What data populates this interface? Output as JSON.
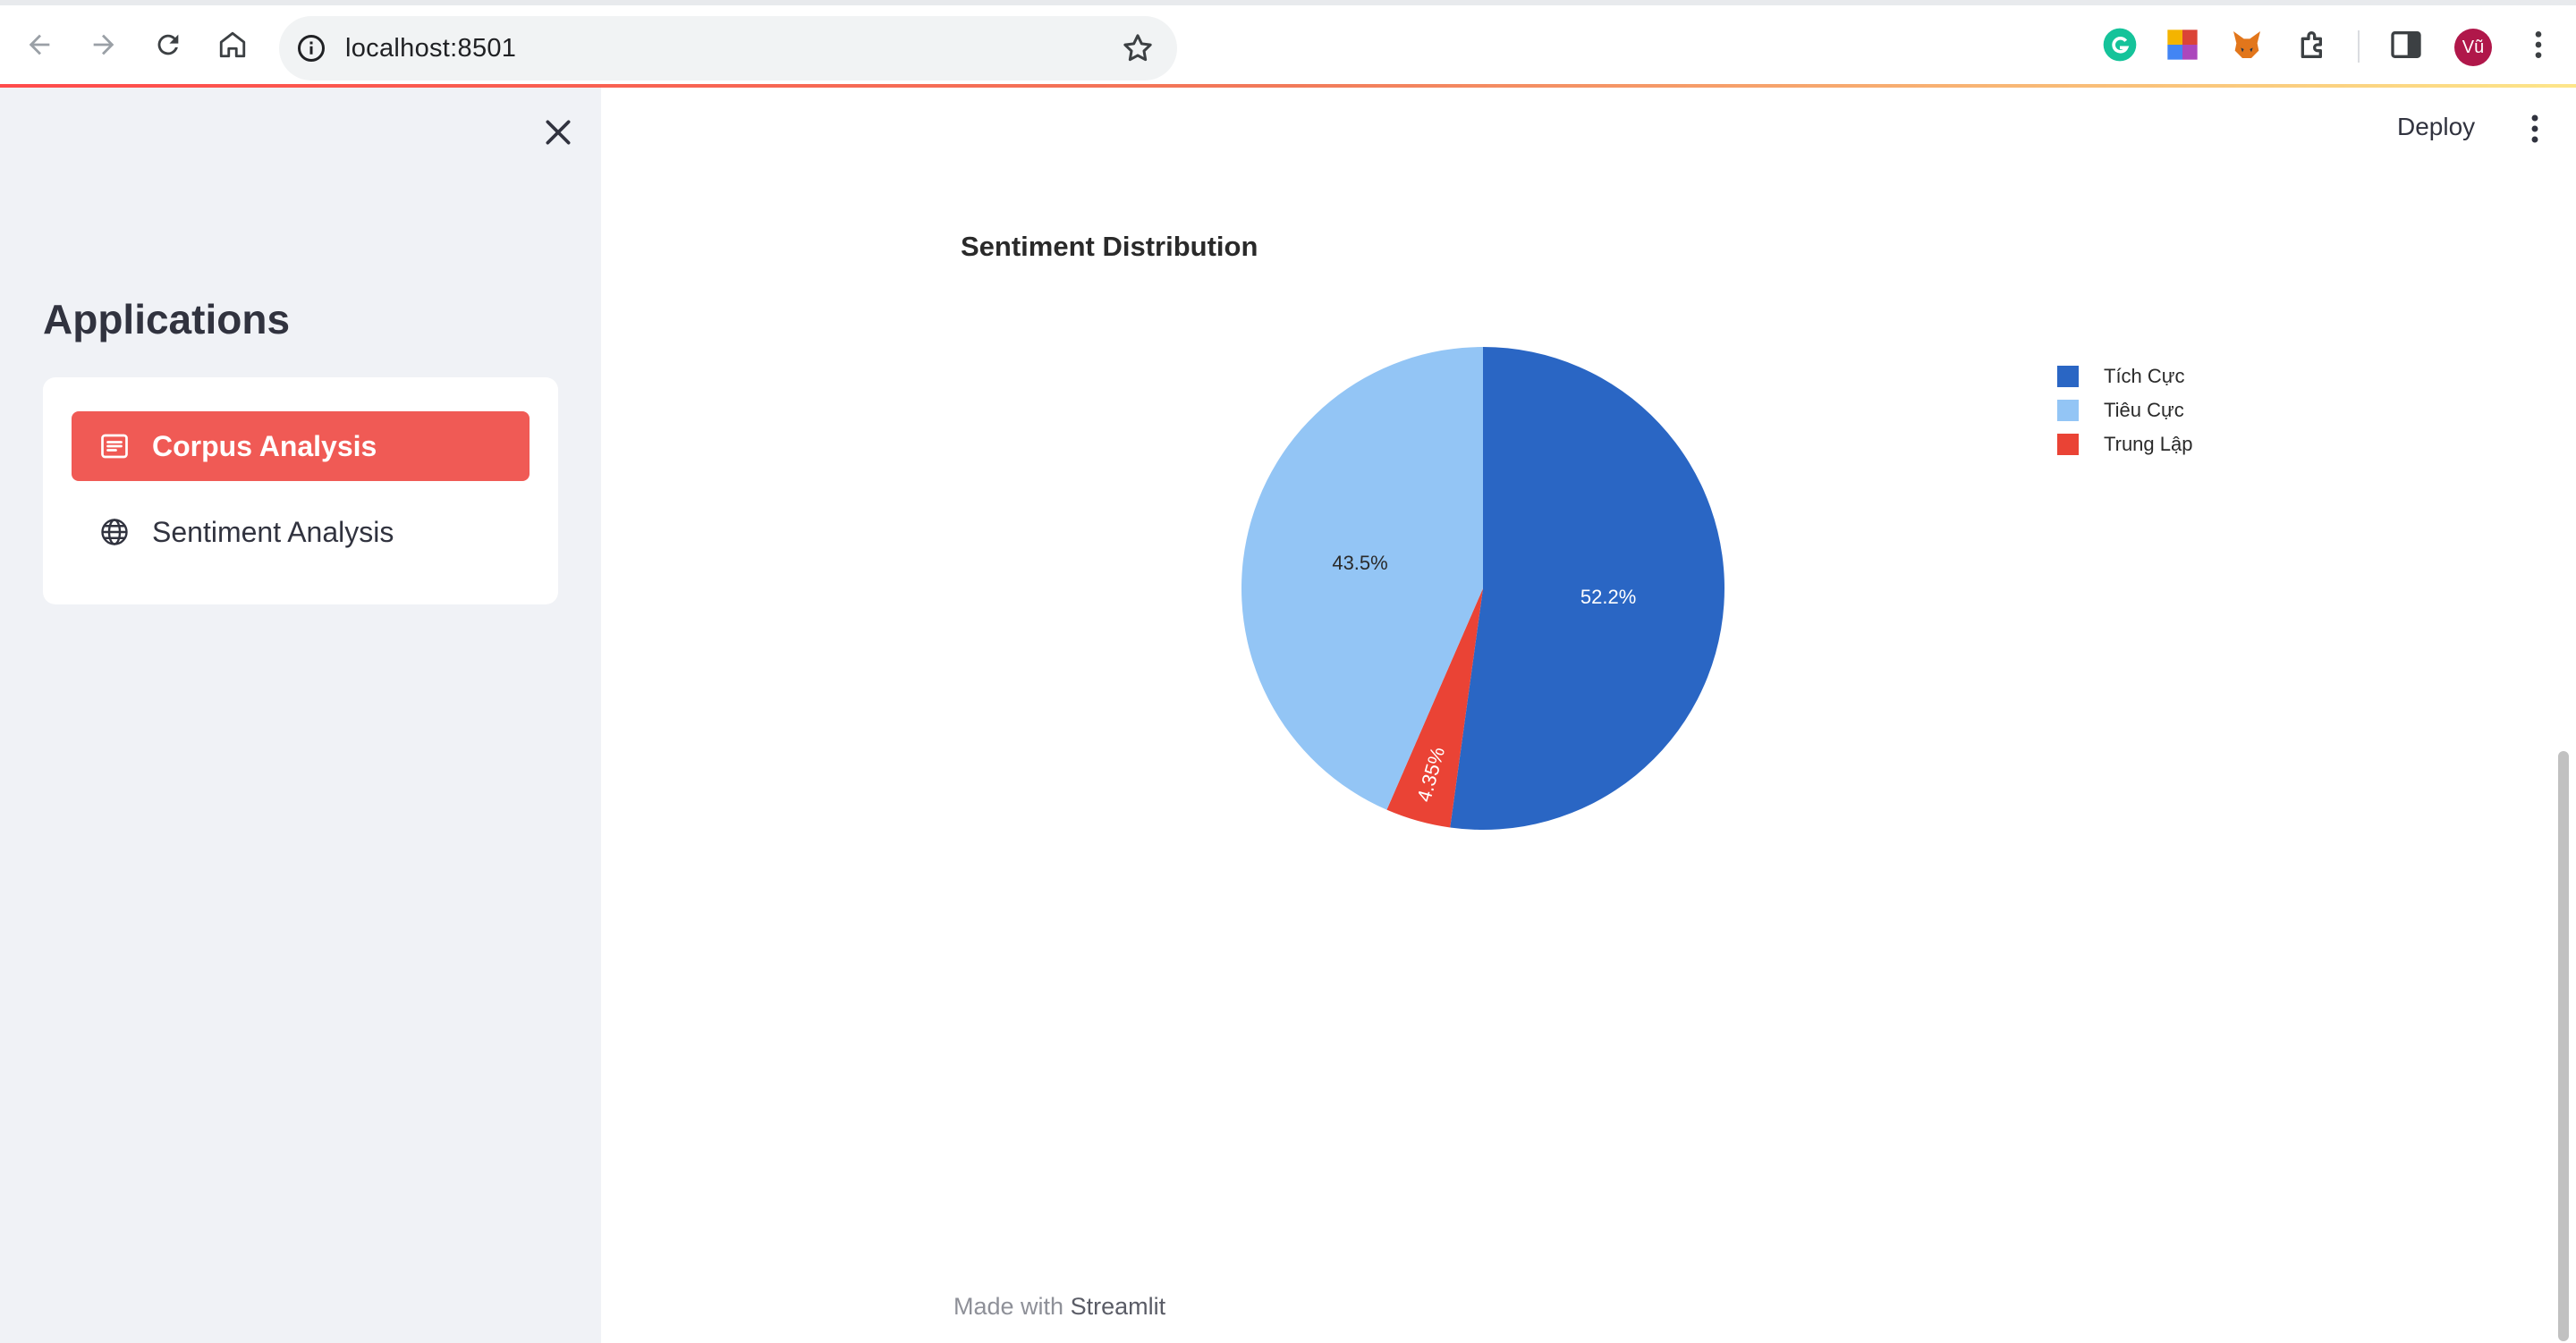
{
  "browser": {
    "url": "localhost:8501",
    "profile_initials": "Vũ"
  },
  "sidebar": {
    "title": "Applications",
    "items": [
      {
        "label": "Corpus Analysis",
        "icon": "document-text-icon",
        "active": true
      },
      {
        "label": "Sentiment Analysis",
        "icon": "globe-icon",
        "active": false
      }
    ]
  },
  "header": {
    "deploy_label": "Deploy"
  },
  "colors": {
    "accent": "#ff4b4b",
    "active_item": "#f05a55",
    "sidebar_bg": "#f0f2f6"
  },
  "footer": {
    "prefix": "Made with",
    "brand": "Streamlit"
  },
  "chart_data": {
    "type": "pie",
    "title": "Sentiment Distribution",
    "slices": [
      {
        "label": "Tích Cực",
        "value": 52.2,
        "display": "52.2%",
        "color": "#2a66c4"
      },
      {
        "label": "Trung Lập",
        "value": 4.35,
        "display": "4.35%",
        "color": "#ea4335"
      },
      {
        "label": "Tiêu Cực",
        "value": 43.5,
        "display": "43.5%",
        "color": "#93c5f5"
      }
    ],
    "legend": [
      "Tích Cực",
      "Tiêu Cực",
      "Trung Lập"
    ],
    "legend_position": "top-right"
  }
}
